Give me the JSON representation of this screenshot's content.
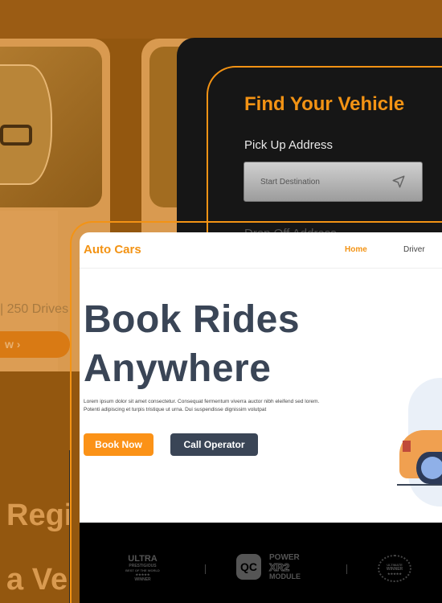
{
  "driver_card": {
    "stats": "|  250 Drives",
    "button_label": "w  ›"
  },
  "find_vehicle": {
    "title": "Find Your Vehicle",
    "pickup_label": "Pick Up Address",
    "pickup_placeholder": "Start Destination",
    "dropoff_label": "Drop Off Address",
    "icon": "navigation-arrow-icon"
  },
  "site": {
    "brand": "Auto Cars",
    "nav": [
      "Home",
      "Driver"
    ],
    "headline_line1": "Book Rides",
    "headline_line2": "Anywhere",
    "description": "Lorem ipsum dolor sit amet consectetur. Consequat fermentum viverra auctor nibh eleifend sed lorem. Potenti adipiscing et turpis tristique ut urna. Dui suspendisse dignissim volutpat",
    "book_button": "Book Now",
    "call_button": "Call Operator"
  },
  "footer_logos": {
    "logo1": [
      "ULTRA",
      "PRESTIGIOUS",
      "BEST OF THE WORLD",
      "★★★★★",
      "WINNER"
    ],
    "logo2_badge": "QC",
    "logo2": [
      "POWER",
      "XR2",
      "MODULE"
    ],
    "logo3": [
      "ULTIMATE",
      "WINNER",
      "★★★★★"
    ]
  },
  "background_text": {
    "line1": "Regi",
    "line2": "a Ve"
  },
  "colors": {
    "accent": "#f39314",
    "dark_text": "#3a4556",
    "panel": "#161616"
  }
}
